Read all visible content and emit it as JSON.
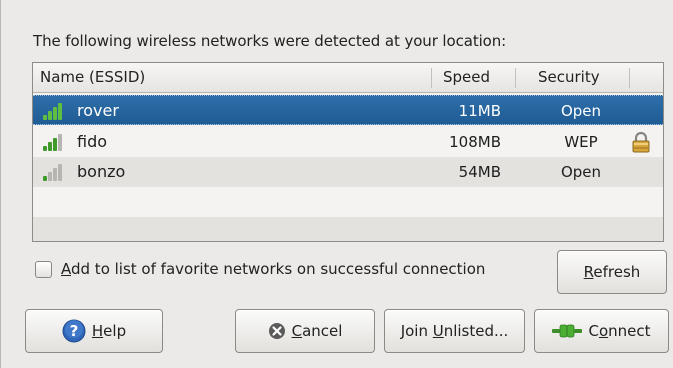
{
  "dialog": {
    "prompt": "The following wireless networks were detected at your location:",
    "columns": {
      "name": "Name (ESSID)",
      "speed": "Speed",
      "security": "Security"
    },
    "networks": [
      {
        "name": "rover",
        "speed": "11MB",
        "security": "Open",
        "selected": true,
        "signal_level": 4,
        "locked": false
      },
      {
        "name": "fido",
        "speed": "108MB",
        "security": "WEP",
        "selected": false,
        "signal_level": 3,
        "locked": true
      },
      {
        "name": "bonzo",
        "speed": "54MB",
        "security": "Open",
        "selected": false,
        "signal_level": 1,
        "locked": false
      }
    ],
    "checkbox": {
      "mnemonic": "A",
      "rest": "dd to list of favorite networks on successful connection",
      "checked": false
    },
    "buttons": {
      "refresh": {
        "mnemonic": "R",
        "rest": "efresh"
      },
      "help": {
        "mnemonic": "H",
        "rest": "elp"
      },
      "cancel": {
        "mnemonic": "C",
        "rest": "ancel"
      },
      "join_prefix": "Join ",
      "join_mnemonic": "U",
      "join_rest": "nlisted...",
      "connect_prefix": "C",
      "connect_mnemonic": "o",
      "connect_rest": "nnect"
    },
    "icons": {
      "signal": "signal-strength-icon",
      "lock": "padlock-icon",
      "help": "help-question-icon",
      "cancel": "cancel-x-icon",
      "connect": "network-plug-icon"
    },
    "colors": {
      "selection": "#2565a0",
      "signal_green": "#3f9a2b",
      "signal_gray": "#b7b5b1"
    }
  }
}
